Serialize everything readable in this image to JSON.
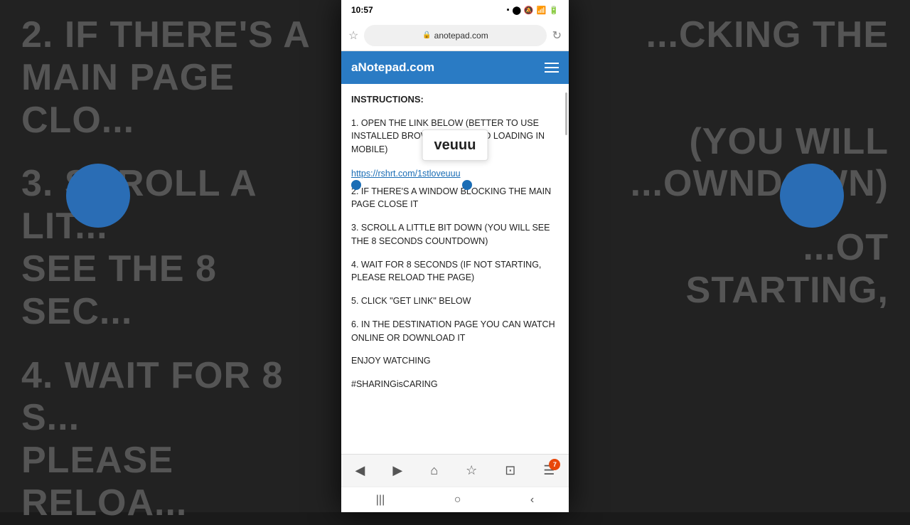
{
  "background": {
    "left_texts": [
      "2. IF THERE'S A",
      "MAIN PAGE CLO...",
      "",
      "3. SCROLL A LIT...",
      "SEE THE 8 SEC...",
      "",
      "4. WAIT FOR 8 S...",
      "PLEASE RELOA..."
    ],
    "right_texts": [
      "...CKING THE",
      "",
      "(YOU WILL",
      "...OWNDOWN)",
      "",
      "...OT STARTING,",
      ""
    ]
  },
  "status_bar": {
    "time": "10:57",
    "signal": "📶",
    "wifi": "WiFi",
    "battery": "🔋"
  },
  "address_bar": {
    "url": "anotepad.com",
    "lock_icon": "🔒"
  },
  "app_header": {
    "title": "aNotepad.com",
    "menu_icon": "≡"
  },
  "content": {
    "instructions_label": "INSTRUCTIONS:",
    "steps": [
      {
        "number": "1",
        "text": "OPEN THE LINK BELOW (BETTER TO USE INSTALLED BROWSER TO AVOID LOADING IN MOBILE)"
      },
      {
        "number": "2",
        "text": "IF THERE'S A WINDOW BLOCKING THE MAIN PAGE CLOSE IT"
      },
      {
        "number": "3",
        "text": "SCROLL A LITTLE BIT DOWN (YOU WILL SEE THE 8 SECONDS COUNTDOWN)"
      },
      {
        "number": "4",
        "text": "WAIT FOR 8 SECONDS (IF NOT STARTING, PLEASE RELOAD THE PAGE)"
      },
      {
        "number": "5",
        "text": "CLICK \"GET LINK\" BELOW"
      },
      {
        "number": "6",
        "text": "IN THE DESTINATION PAGE YOU CAN WATCH ONLINE OR DOWNLOAD IT"
      }
    ],
    "link": "https://rshrt.com/1stloveuuu",
    "enjoy_text": "ENJOY WATCHING",
    "hashtag": "#SHARINGisCARING",
    "tooltip_text": "veuuu"
  },
  "bottom_nav": {
    "back_label": "◀",
    "forward_label": "▶",
    "home_label": "⌂",
    "bookmark_label": "☆",
    "tabs_label": "⊡",
    "menu_label": "☰",
    "badge_count": "7"
  },
  "android_bar": {
    "menu_btn": "|||",
    "home_btn": "○",
    "back_btn": "‹"
  }
}
